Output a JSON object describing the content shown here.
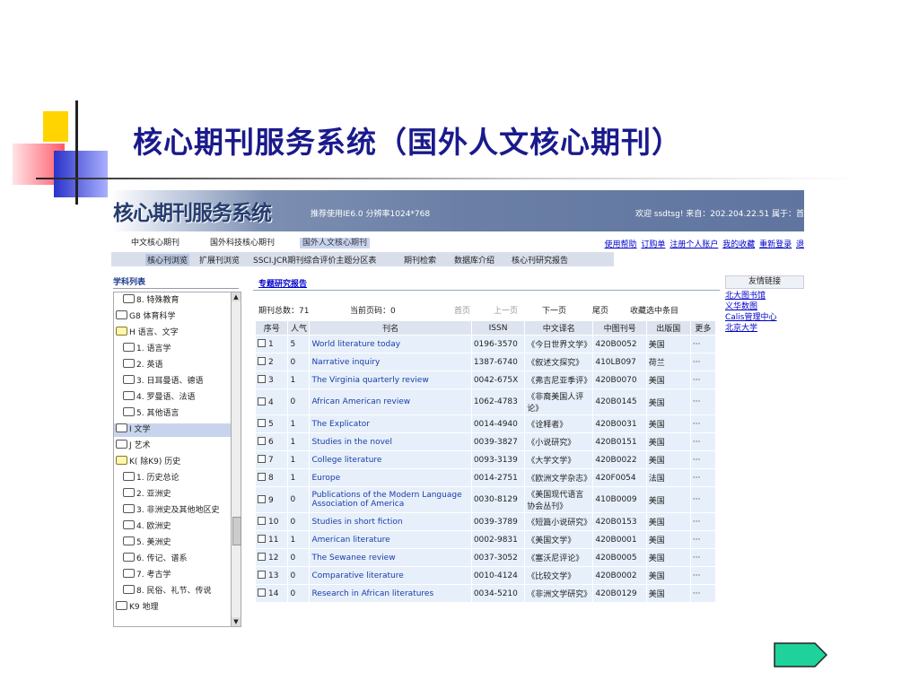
{
  "slide": {
    "title": "核心期刊服务系统（国外人文核心期刊）"
  },
  "app": {
    "logo": "核心期刊服务系统",
    "recommend": "推荐使用IE6.0 分辨率1024*768",
    "welcome": "欢迎 ssdtsg! 来自：202.204.22.51 属于：首"
  },
  "tabs": [
    "中文核心期刊",
    "国外科技核心期刊",
    "国外人文核心期刊"
  ],
  "toplinks": [
    "使用帮助",
    "订购单",
    "注册个人账户",
    "我的收藏",
    "重新登录",
    "退"
  ],
  "subtabs": [
    "核心刊浏览",
    "扩展刊浏览",
    "SSCI.JCR期刊综合评价主题分区表",
    "期刊检索",
    "数据库介绍",
    "核心刊研究报告"
  ],
  "sidebar": {
    "heading": "学科列表",
    "items": [
      {
        "label": "8. 特殊教育",
        "indent": true,
        "open": false,
        "sel": false
      },
      {
        "label": "G8 体育科学",
        "indent": false,
        "open": false,
        "sel": false
      },
      {
        "label": "H 语言、文字",
        "indent": false,
        "open": true,
        "sel": false
      },
      {
        "label": "1. 语言学",
        "indent": true,
        "open": false,
        "sel": false
      },
      {
        "label": "2. 英语",
        "indent": true,
        "open": false,
        "sel": false
      },
      {
        "label": "3. 日耳曼语、德语",
        "indent": true,
        "open": false,
        "sel": false
      },
      {
        "label": "4. 罗曼语、法语",
        "indent": true,
        "open": false,
        "sel": false
      },
      {
        "label": "5. 其他语言",
        "indent": true,
        "open": false,
        "sel": false
      },
      {
        "label": "I 文学",
        "indent": false,
        "open": false,
        "sel": true
      },
      {
        "label": "J 艺术",
        "indent": false,
        "open": false,
        "sel": false
      },
      {
        "label": "K( 除K9) 历史",
        "indent": false,
        "open": true,
        "sel": false
      },
      {
        "label": "1. 历史总论",
        "indent": true,
        "open": false,
        "sel": false
      },
      {
        "label": "2. 亚洲史",
        "indent": true,
        "open": false,
        "sel": false
      },
      {
        "label": "3. 非洲史及其他地区史",
        "indent": true,
        "open": false,
        "sel": false
      },
      {
        "label": "4. 欧洲史",
        "indent": true,
        "open": false,
        "sel": false
      },
      {
        "label": "5. 美洲史",
        "indent": true,
        "open": false,
        "sel": false
      },
      {
        "label": "6. 传记、谱系",
        "indent": true,
        "open": false,
        "sel": false
      },
      {
        "label": "7. 考古学",
        "indent": true,
        "open": false,
        "sel": false
      },
      {
        "label": "8. 民俗、礼节、传说",
        "indent": true,
        "open": false,
        "sel": false
      },
      {
        "label": "K9 地理",
        "indent": false,
        "open": false,
        "sel": false
      }
    ]
  },
  "main": {
    "report_link": "专题研究报告",
    "total_label": "期刊总数：71",
    "current_page": "当前页码：0",
    "pager": [
      "首页",
      "上一页",
      "下一页",
      "尾页",
      "收藏选中条目"
    ],
    "columns": [
      "序号",
      "人气",
      "刊名",
      "ISSN",
      "中文译名",
      "中图刊号",
      "出版国",
      "更多"
    ],
    "rows": [
      [
        "1",
        "5",
        "World literature today",
        "0196-3570",
        "《今日世界文学》",
        "420B0052",
        "美国",
        "···"
      ],
      [
        "2",
        "0",
        "Narrative inquiry",
        "1387-6740",
        "《叙述文探究》",
        "410LB097",
        "荷兰",
        "···"
      ],
      [
        "3",
        "1",
        "The Virginia quarterly review",
        "0042-675X",
        "《弗吉尼亚季评》",
        "420B0070",
        "美国",
        "···"
      ],
      [
        "4",
        "0",
        "African American review",
        "1062-4783",
        "《非裔美国人评论》",
        "420B0145",
        "美国",
        "···"
      ],
      [
        "5",
        "1",
        "The Explicator",
        "0014-4940",
        "《诠释者》",
        "420B0031",
        "美国",
        "···"
      ],
      [
        "6",
        "1",
        "Studies in the novel",
        "0039-3827",
        "《小说研究》",
        "420B0151",
        "美国",
        "···"
      ],
      [
        "7",
        "1",
        "College literature",
        "0093-3139",
        "《大学文学》",
        "420B0022",
        "美国",
        "···"
      ],
      [
        "8",
        "1",
        "Europe",
        "0014-2751",
        "《欧洲文学杂志》",
        "420F0054",
        "法国",
        "···"
      ],
      [
        "9",
        "0",
        "Publications of the Modern Language Association of America",
        "0030-8129",
        "《美国现代语言协会丛刊》",
        "410B0009",
        "美国",
        "···"
      ],
      [
        "10",
        "0",
        "Studies in short fiction",
        "0039-3789",
        "《短篇小说研究》",
        "420B0153",
        "美国",
        "···"
      ],
      [
        "11",
        "1",
        "American literature",
        "0002-9831",
        "《美国文学》",
        "420B0001",
        "美国",
        "···"
      ],
      [
        "12",
        "0",
        "The Sewanee review",
        "0037-3052",
        "《塞沃尼评论》",
        "420B0005",
        "美国",
        "···"
      ],
      [
        "13",
        "0",
        "Comparative literature",
        "0010-4124",
        "《比较文学》",
        "420B0002",
        "美国",
        "···"
      ],
      [
        "14",
        "0",
        "Research in African literatures",
        "0034-5210",
        "《非洲文学研究》",
        "420B0129",
        "美国",
        "···"
      ]
    ]
  },
  "links": {
    "heading": "友情链接",
    "items": [
      "北大图书馆",
      "义华数图",
      "Calis管理中心",
      "北京大学"
    ]
  },
  "colors": {
    "title": "#1a1a8c",
    "next_button": "#1fd19a"
  },
  "icons": {
    "next": "next-arrow-icon",
    "folder": "folder-icon",
    "book": "book-icon"
  }
}
